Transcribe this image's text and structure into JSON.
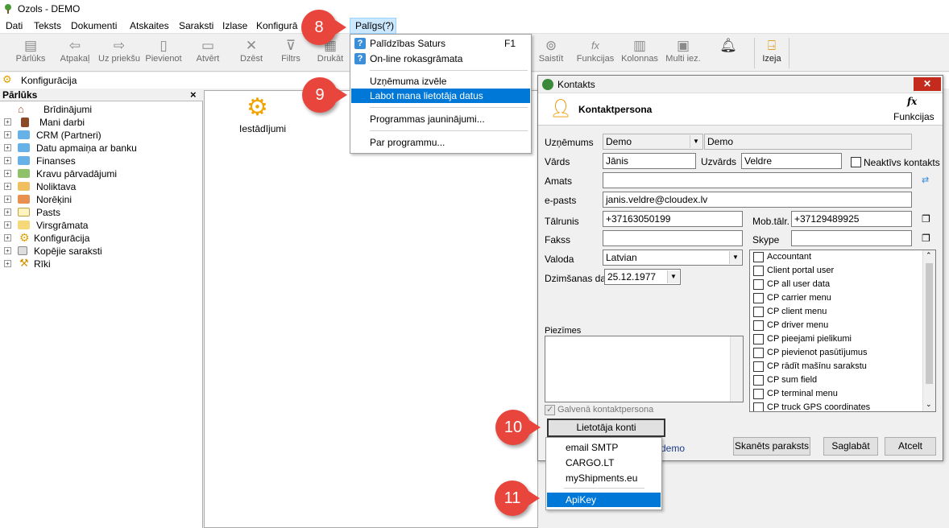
{
  "app": {
    "title": "Ozols - DEMO"
  },
  "menu": [
    "Dati",
    "Teksts",
    "Dokumenti",
    "Atskaites",
    "Saraksti",
    "Izlase",
    "Konfigurā",
    "Palīgs(?)"
  ],
  "toolbar": {
    "left": [
      "Pārlūks",
      "Atpakaļ",
      "Uz priekšu",
      "Pievienot",
      "Atvērt",
      "Dzēst",
      "Filtrs",
      "Drukāt"
    ],
    "right": [
      "Saistīt",
      "Funkcijas",
      "Kolonnas",
      "Multi iez.",
      "Izeja"
    ]
  },
  "breadcrumb": "Konfigurācija",
  "browser": {
    "title": "Pārlūks",
    "close": "×",
    "items": [
      "Brīdinājumi",
      "Mani darbi",
      "CRM (Partneri)",
      "Datu apmaiņa ar banku",
      "Finanses",
      "Kravu pārvadājumi",
      "Noliktava",
      "Norēķini",
      "Pasts",
      "Virsgrāmata",
      "Konfigurācija",
      "Kopējie saraksti",
      "Rīki"
    ]
  },
  "main": {
    "settings_label": "Iestādījumi"
  },
  "help_menu": {
    "items": [
      {
        "label": "Palīdzības Saturs",
        "key": "F1"
      },
      {
        "label": "On-line rokasgrāmata",
        "key": ""
      },
      {
        "label": "Uzņēmuma izvēle",
        "key": ""
      },
      {
        "label": "Labot mana lietotāja datus",
        "key": ""
      },
      {
        "label": "Programmas jauninājumi...",
        "key": ""
      },
      {
        "label": "Par programmu...",
        "key": ""
      }
    ]
  },
  "dialog": {
    "title": "Kontakts",
    "header": "Kontaktpersona",
    "functions": "Funkcijas",
    "labels": {
      "company": "Uzņēmums",
      "first_name": "Vārds",
      "last_name": "Uzvārds",
      "inactive": "Neaktīvs kontakts",
      "position": "Amats",
      "email": "e-pasts",
      "phone": "Tālrunis",
      "mobile": "Mob.tālr.",
      "fax": "Fakss",
      "skype": "Skype",
      "language": "Valoda",
      "birthdate": "Dzimšanas dat.",
      "notes": "Piezīmes",
      "main_contact": "Galvenā kontaktpersona"
    },
    "values": {
      "company": "Demo",
      "company2": "Demo",
      "first_name": "Jānis",
      "last_name": "Veldre",
      "position": "",
      "email": "janis.veldre@cloudex.lv",
      "phone": "+37163050199",
      "mobile": "+37129489925",
      "fax": "",
      "skype": "",
      "language": "Latvian",
      "birthdate": "25.12.1977",
      "demo_text": "demo"
    },
    "roles": [
      "Accountant",
      "Client portal user",
      "CP all user data",
      "CP carrier menu",
      "CP client menu",
      "CP driver menu",
      "CP pieejami pielikumi",
      "CP pievienot pasūtījumus",
      "CP rādīt mašīnu sarakstu",
      "CP sum field",
      "CP terminal menu",
      "CP truck GPS coordinates"
    ],
    "buttons": {
      "user_accounts": "Lietotāja konti",
      "scanned_sig": "Skanēts paraksts",
      "save": "Saglabāt",
      "cancel": "Atcelt"
    }
  },
  "accounts_menu": [
    "email SMTP",
    "CARGO.LT",
    "myShipments.eu",
    "ApiKey"
  ],
  "badges": [
    "8",
    "9",
    "10",
    "11"
  ]
}
